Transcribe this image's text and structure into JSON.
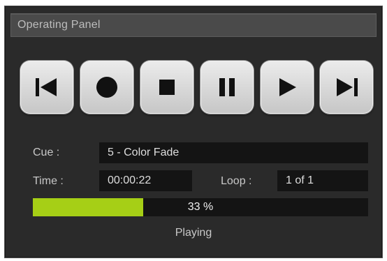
{
  "panel": {
    "title": "Operating Panel"
  },
  "transport": {
    "buttons": [
      {
        "name": "previous",
        "icon": "skip-back-icon"
      },
      {
        "name": "record",
        "icon": "record-icon"
      },
      {
        "name": "stop",
        "icon": "stop-icon"
      },
      {
        "name": "pause",
        "icon": "pause-icon"
      },
      {
        "name": "play",
        "icon": "play-icon"
      },
      {
        "name": "next",
        "icon": "skip-forward-icon"
      }
    ]
  },
  "info": {
    "cue_label": "Cue :",
    "cue_value": "5 - Color Fade",
    "time_label": "Time :",
    "time_value": "00:00:22",
    "loop_label": "Loop :",
    "loop_value": "1 of 1"
  },
  "progress": {
    "percent": 33,
    "text": "33 %",
    "fill_color": "#a6cf16"
  },
  "status": {
    "text": "Playing"
  }
}
